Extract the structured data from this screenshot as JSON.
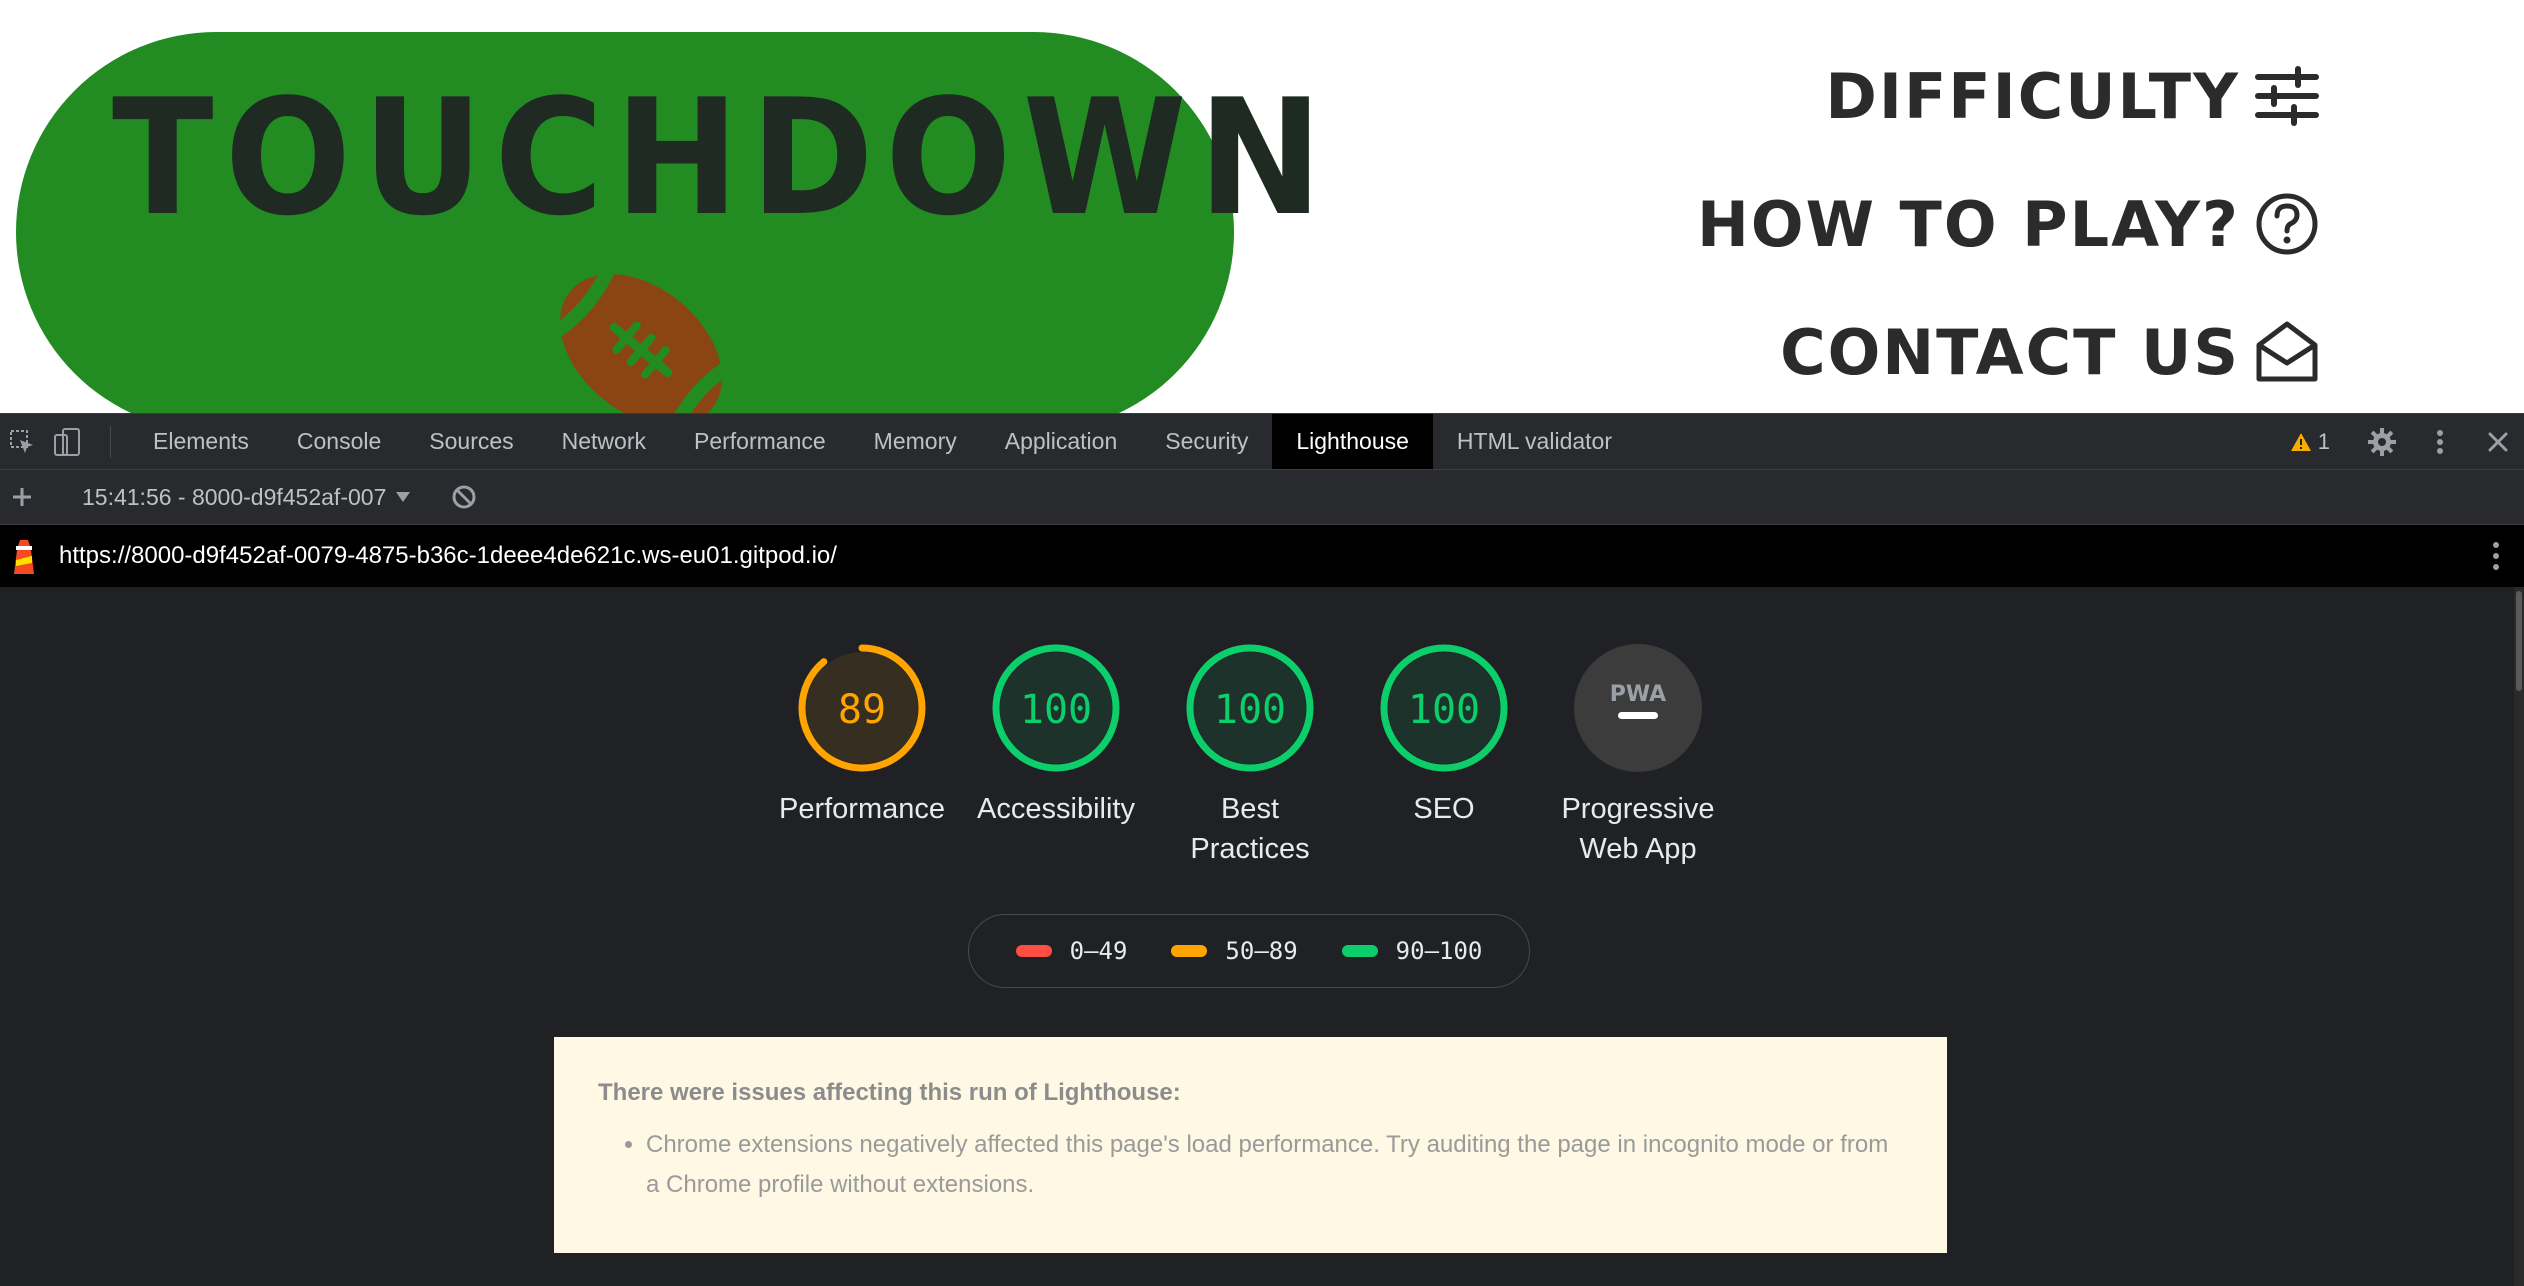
{
  "site": {
    "logo_text": "TOUCHDOWN",
    "nav": {
      "difficulty": "DIFFICULTY",
      "how_to_play": "HOW TO PLAY?",
      "contact_us": "CONTACT US"
    },
    "icons": {
      "difficulty": "sliders-icon",
      "how_to_play": "question-circle-icon",
      "contact_us": "open-envelope-icon",
      "logo": "football-icon"
    },
    "colors": {
      "brand_green": "#228b22",
      "logo_text": "#1f2a22",
      "football": "#8b4513"
    }
  },
  "devtools": {
    "tabs": [
      "Elements",
      "Console",
      "Sources",
      "Network",
      "Performance",
      "Memory",
      "Application",
      "Security",
      "Lighthouse",
      "HTML validator"
    ],
    "active_tab": "Lighthouse",
    "warning_count": "1",
    "report_selector": "15:41:56 - 8000-d9f452af-007",
    "url": "https://8000-d9f452af-0079-4875-b36c-1deee4de621c.ws-eu01.gitpod.io/"
  },
  "lighthouse": {
    "categories": [
      {
        "label": "Performance",
        "score": "89",
        "value": 89,
        "color": "#ffa400"
      },
      {
        "label": "Accessibility",
        "score": "100",
        "value": 100,
        "color": "#0cce6b"
      },
      {
        "label": "Best\nPractices",
        "score": "100",
        "value": 100,
        "color": "#0cce6b"
      },
      {
        "label": "SEO",
        "score": "100",
        "value": 100,
        "color": "#0cce6b"
      },
      {
        "label": "Progressive\nWeb App",
        "score": "PWA",
        "value": null,
        "color": "#5f6368"
      }
    ],
    "legend": [
      {
        "range": "0–49",
        "color": "#ff4e42"
      },
      {
        "range": "50–89",
        "color": "#ffa400"
      },
      {
        "range": "90–100",
        "color": "#0cce6b"
      }
    ],
    "warning": {
      "title": "There were issues affecting this run of Lighthouse:",
      "items": [
        "Chrome extensions negatively affected this page's load performance. Try auditing the page in incognito mode or from a Chrome profile without extensions."
      ]
    }
  }
}
